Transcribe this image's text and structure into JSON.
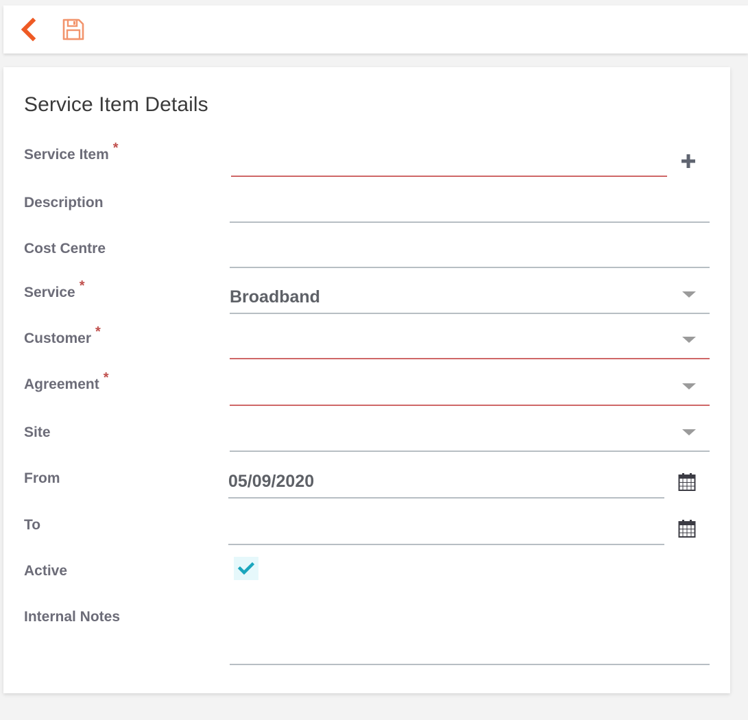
{
  "toolbar": {
    "back_icon": "chevron-left-icon",
    "save_icon": "floppy-disk-icon",
    "accent_color": "#ee5a24",
    "save_color": "#f2946c"
  },
  "form": {
    "title": "Service Item Details",
    "required_marker": "*",
    "fields": {
      "service_item": {
        "label": "Service Item",
        "value": "",
        "required": true
      },
      "description": {
        "label": "Description",
        "value": ""
      },
      "cost_centre": {
        "label": "Cost Centre",
        "value": ""
      },
      "service": {
        "label": "Service",
        "value": "Broadband",
        "required": true
      },
      "customer": {
        "label": "Customer",
        "value": "",
        "required": true
      },
      "agreement": {
        "label": "Agreement",
        "value": "",
        "required": true
      },
      "site": {
        "label": "Site",
        "value": ""
      },
      "from": {
        "label": "From",
        "value": "05/09/2020"
      },
      "to": {
        "label": "To",
        "value": ""
      },
      "active": {
        "label": "Active",
        "checked": true
      },
      "internal_notes": {
        "label": "Internal Notes",
        "value": ""
      }
    }
  }
}
